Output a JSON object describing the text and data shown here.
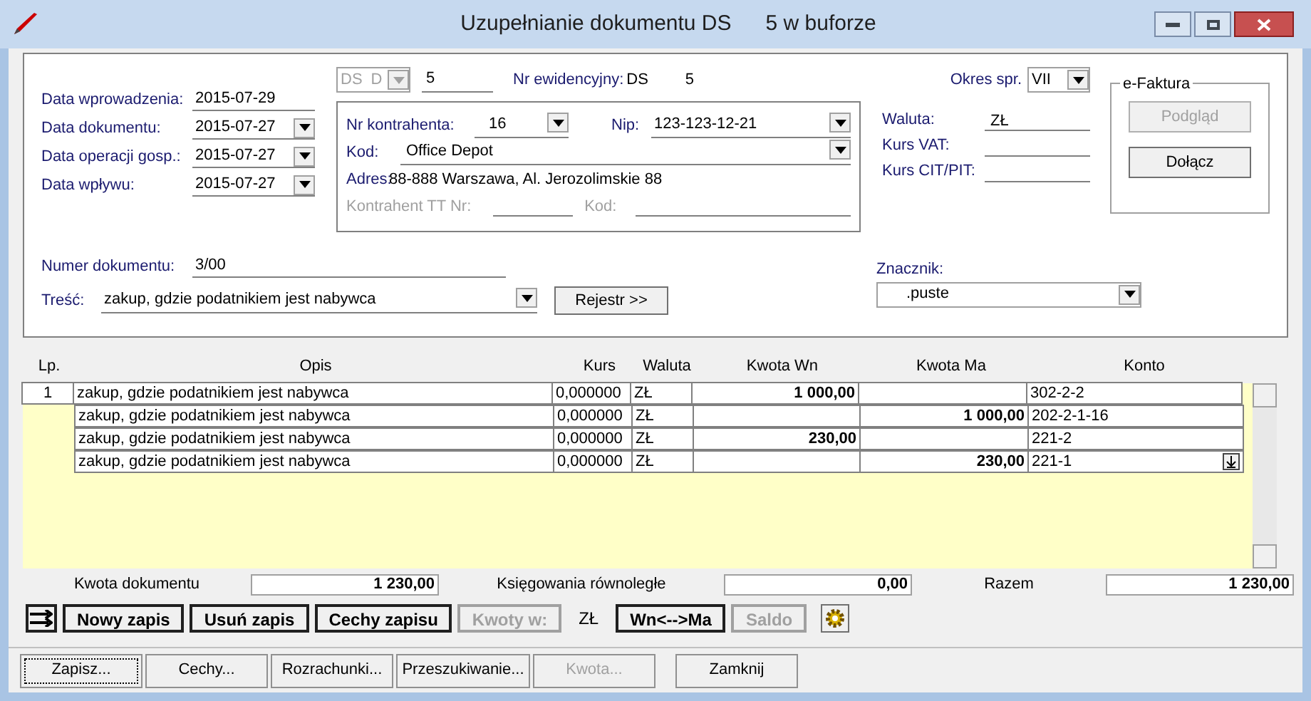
{
  "window": {
    "title": "Uzupełnianie dokumentu DS",
    "title_suffix": "5 w buforze"
  },
  "dates": [
    {
      "label": "Data wprowadzenia:",
      "value": "2015-07-29",
      "dropdown": false
    },
    {
      "label": "Data dokumentu:",
      "value": "2015-07-27",
      "dropdown": true
    },
    {
      "label": "Data operacji gosp.:",
      "value": "2015-07-27",
      "dropdown": true
    },
    {
      "label": "Data wpływu:",
      "value": "2015-07-27",
      "dropdown": true
    }
  ],
  "document_type": {
    "value": "DS",
    "code": "D",
    "disabled": true
  },
  "document_number": "5",
  "registry": {
    "label": "Nr ewidencyjny:",
    "prefix": "DS",
    "number": "5"
  },
  "contractor": {
    "number_label": "Nr kontrahenta:",
    "number": "16",
    "nip_label": "Nip:",
    "nip": "123-123-12-21",
    "code_label": "Kod:",
    "code": "Office Depot",
    "address_label": "Adres:",
    "address": "88-888 Warszawa, Al. Jerozolimskie 88",
    "tt_label": "Kontrahent TT Nr:",
    "tt_code_label": "Kod:"
  },
  "period": {
    "label": "Okres spr.",
    "value": "VII"
  },
  "currency": [
    {
      "label": "Waluta:",
      "value": "ZŁ"
    },
    {
      "label": "Kurs VAT:"
    },
    {
      "label": "Kurs CIT/PIT:"
    }
  ],
  "efaktura": {
    "title": "e-Faktura",
    "buttons": [
      {
        "label": "Podgląd",
        "disabled": true
      },
      {
        "label": "Dołącz",
        "disabled": false
      }
    ]
  },
  "doc_number": {
    "label": "Numer dokumentu:",
    "value": "3/00"
  },
  "description": {
    "label": "Treść:",
    "value": "zakup, gdzie podatnikiem jest nabywca",
    "button": "Rejestr >>"
  },
  "marker": {
    "label": "Znacznik:",
    "value": ".puste"
  },
  "table": {
    "columns": [
      "Lp.",
      "Opis",
      "Kurs",
      "Waluta",
      "Kwota Wn",
      "Kwota Ma",
      "Konto"
    ],
    "rows": [
      {
        "lp": "1",
        "opis": "zakup, gdzie podatnikiem jest nabywca",
        "kurs": "0,000000",
        "waluta": "ZŁ",
        "wn": "1 000,00",
        "konto": "302-2-2",
        "editing": false
      },
      {
        "opis": "zakup, gdzie podatnikiem jest nabywca",
        "kurs": "0,000000",
        "waluta": "ZŁ",
        "ma": "1 000,00",
        "konto": "202-2-1-16",
        "editing": false
      },
      {
        "opis": "zakup, gdzie podatnikiem jest nabywca",
        "kurs": "0,000000",
        "waluta": "ZŁ",
        "wn": "230,00",
        "konto": "221-2",
        "editing": false
      },
      {
        "opis": "zakup, gdzie podatnikiem jest nabywca",
        "kurs": "0,000000",
        "waluta": "ZŁ",
        "ma": "230,00",
        "konto": "221-1",
        "editing": true
      }
    ]
  },
  "totals": [
    {
      "label": "Kwota dokumentu",
      "value": "1 230,00"
    },
    {
      "label": "Księgowania równoległe",
      "value": "0,00"
    },
    {
      "label": "Razem",
      "value": "1 230,00"
    }
  ],
  "entry_toolbar": [
    {
      "kind": "arrows-button"
    },
    {
      "kind": "button",
      "label": "Nowy zapis",
      "disabled": false
    },
    {
      "kind": "button",
      "label": "Usuń zapis",
      "disabled": false
    },
    {
      "kind": "button",
      "label": "Cechy zapisu",
      "disabled": false
    },
    {
      "kind": "button",
      "label": "Kwoty w:",
      "disabled": true
    },
    {
      "kind": "label",
      "label": "ZŁ"
    },
    {
      "kind": "button",
      "label": "Wn<-->Ma",
      "disabled": false
    },
    {
      "kind": "button",
      "label": "Saldo",
      "disabled": true
    },
    {
      "kind": "gear-button"
    }
  ],
  "footer_buttons": [
    {
      "label": "Zapisz...",
      "disabled": false,
      "focused": true
    },
    {
      "label": "Cechy...",
      "disabled": false,
      "focused": false
    },
    {
      "label": "Rozrachunki...",
      "disabled": false,
      "focused": false
    },
    {
      "label": "Przeszukiwanie...",
      "disabled": false,
      "focused": false
    },
    {
      "label": "Kwota...",
      "disabled": true,
      "focused": false
    },
    {
      "label": "Zamknij",
      "disabled": false,
      "focused": false
    }
  ]
}
